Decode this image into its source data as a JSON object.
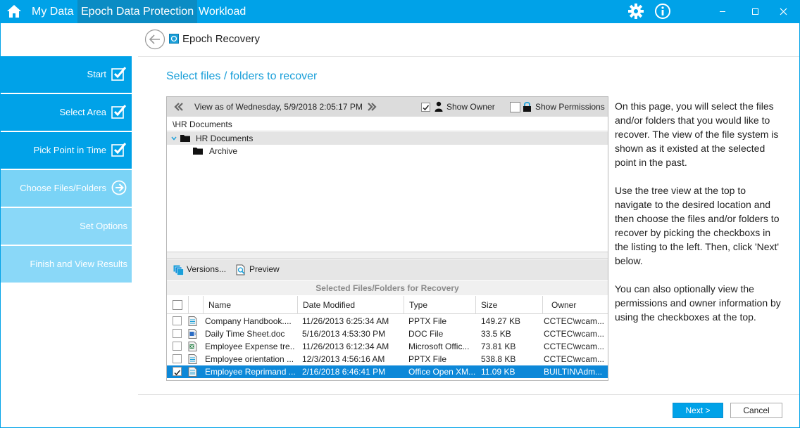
{
  "topbar": {
    "tabs": [
      "My Data",
      "Epoch Data Protection",
      "Workload"
    ],
    "active_tab": "Epoch Data Protection"
  },
  "header": {
    "title": "Epoch Recovery"
  },
  "sidebar": {
    "steps": [
      {
        "label": "Start",
        "state": "done"
      },
      {
        "label": "Select Area",
        "state": "done"
      },
      {
        "label": "Pick Point in Time",
        "state": "done"
      },
      {
        "label": "Choose Files/Folders",
        "state": "current"
      },
      {
        "label": "Set Options",
        "state": "todo"
      },
      {
        "label": "Finish and View Results",
        "state": "todo"
      }
    ]
  },
  "main": {
    "title": "Select files / folders to recover",
    "view_as": "View as of Wednesday, 5/9/2018 2:05:17 PM",
    "show_owner_label": "Show Owner",
    "show_owner_checked": true,
    "show_permissions_label": "Show Permissions",
    "show_permissions_checked": false,
    "path": "\\HR Documents",
    "tree": [
      {
        "label": "HR Documents",
        "level": 0,
        "expanded": true
      },
      {
        "label": "Archive",
        "level": 1,
        "expanded": false
      }
    ],
    "versions_label": "Versions...",
    "preview_label": "Preview",
    "selected_title": "Selected Files/Folders for Recovery",
    "columns": [
      "Name",
      "Date Modified",
      "Type",
      "Size",
      "Owner"
    ],
    "rows": [
      {
        "name": "Company Handbook....",
        "date": "11/26/2013 6:25:34 AM",
        "type": "PPTX File",
        "size": "149.27 KB",
        "owner": "CCTEC\\wcam...",
        "checked": false,
        "selected": false,
        "icon": "document-icon"
      },
      {
        "name": "Daily Time Sheet.doc",
        "date": "5/16/2013 4:53:30 PM",
        "type": "DOC File",
        "size": "33.5 KB",
        "owner": "CCTEC\\wcam...",
        "checked": false,
        "selected": false,
        "icon": "doc-icon"
      },
      {
        "name": "Employee Expense tre...",
        "date": "11/26/2013 6:12:34 AM",
        "type": "Microsoft Offic...",
        "size": "73.81 KB",
        "owner": "CCTEC\\wcam...",
        "checked": false,
        "selected": false,
        "icon": "excel-icon"
      },
      {
        "name": "Employee orientation ...",
        "date": "12/3/2013 4:56:16 AM",
        "type": "PPTX File",
        "size": "538.8 KB",
        "owner": "CCTEC\\wcam...",
        "checked": false,
        "selected": false,
        "icon": "document-icon"
      },
      {
        "name": "Employee Reprimand ...",
        "date": "2/16/2018 6:46:41 PM",
        "type": "Office Open XM...",
        "size": "11.09 KB",
        "owner": "BUILTIN\\Adm...",
        "checked": true,
        "selected": true,
        "icon": "document-icon"
      }
    ]
  },
  "help": {
    "paragraphs": [
      "On this page, you will select the files and/or folders that you would like to recover. The view of the file system is shown as it existed at the selected point in the past.",
      "Use the tree view at the top to navigate to the desired location and then choose the files and/or folders to recover by picking the checkboxs in the listing to the left. Then, click 'Next' below.",
      "You can also optionally view the permissions and owner information by using the checkboxes at the top."
    ]
  },
  "footer": {
    "next_label": "Next >",
    "cancel_label": "Cancel"
  },
  "colors": {
    "accent": "#00a2e8",
    "selection": "#0d88d8",
    "step_todo": "#8ad8f8"
  }
}
